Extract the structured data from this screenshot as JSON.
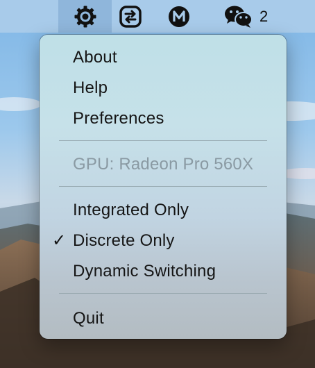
{
  "menubar": {
    "items": [
      {
        "icon": "gear-icon",
        "active": true
      },
      {
        "icon": "switch-icon"
      },
      {
        "icon": "m-circle-icon"
      },
      {
        "icon": "wechat-icon"
      }
    ],
    "badge": "2"
  },
  "menu": {
    "about": "About",
    "help": "Help",
    "preferences": "Preferences",
    "gpu_info": "GPU: Radeon Pro 560X",
    "integrated": "Integrated Only",
    "discrete": "Discrete Only",
    "discrete_checked": true,
    "check": "✓",
    "dynamic": "Dynamic Switching",
    "quit": "Quit"
  },
  "colors": {
    "menubar": "#a8cbea",
    "menubar_active": "#8fb6db",
    "disabled_text": "#8a9aa3"
  }
}
